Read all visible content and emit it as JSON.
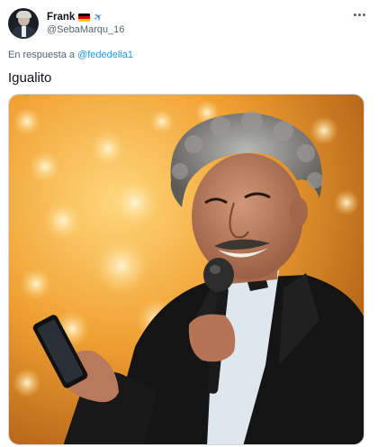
{
  "author": {
    "display_name": "Frank",
    "handle": "@SebaMarqu_16",
    "badges": [
      "germany-flag-icon",
      "airplane-icon"
    ]
  },
  "reply": {
    "prefix": "En respuesta a",
    "mention": "@fededelia1"
  },
  "tweet": {
    "text": "Igualito"
  },
  "media": {
    "type": "photo",
    "colors": {
      "background_warm": "#e8921c",
      "bokeh": "#fff2b8",
      "suit": "#161616",
      "skin": "#b97d5f",
      "hair": "#8a8a8a"
    }
  },
  "colors": {
    "text_primary": "#0f1419",
    "text_secondary": "#536471",
    "link": "#1d9bf0",
    "border": "#cfd9de"
  }
}
